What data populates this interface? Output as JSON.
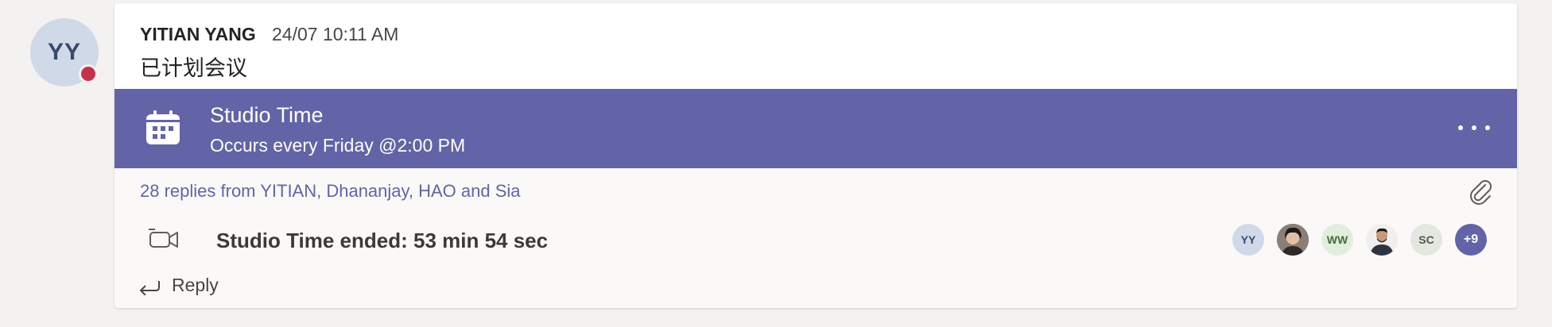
{
  "author": {
    "initials": "YY",
    "name": "YITIAN YANG",
    "timestamp": "24/07 10:11 AM",
    "presence_color": "#c4314b"
  },
  "message": {
    "text": "已计划会议"
  },
  "meeting": {
    "title": "Studio Time",
    "recurrence": "Occurs every Friday @2:00 PM",
    "banner_color": "#6264a7",
    "icon": "calendar-icon",
    "more_icon": "more-options-icon"
  },
  "thread": {
    "replies_text": "28 replies from YITIAN, Dhananjay, HAO and Sia",
    "attachment_icon": "paperclip-icon"
  },
  "call": {
    "icon": "video-call-icon",
    "ended_text": "Studio Time ended: 53 min 54 sec"
  },
  "participants": [
    {
      "initials": "YY",
      "type": "initials",
      "bg": "#cfd9e8",
      "fg": "#3a4a6b"
    },
    {
      "initials": "",
      "type": "photo",
      "bg": "#5a5552",
      "fg": "#ffffff"
    },
    {
      "initials": "WW",
      "type": "initials",
      "bg": "#e1eedb",
      "fg": "#4b6a3c"
    },
    {
      "initials": "",
      "type": "photo",
      "bg": "#ededed",
      "fg": "#333333"
    },
    {
      "initials": "SC",
      "type": "initials",
      "bg": "#e4e6e0",
      "fg": "#4f5a48"
    },
    {
      "initials": "+9",
      "type": "overflow",
      "bg": "#6264a7",
      "fg": "#ffffff"
    }
  ],
  "reply": {
    "label": "Reply",
    "icon": "reply-arrow-icon"
  }
}
